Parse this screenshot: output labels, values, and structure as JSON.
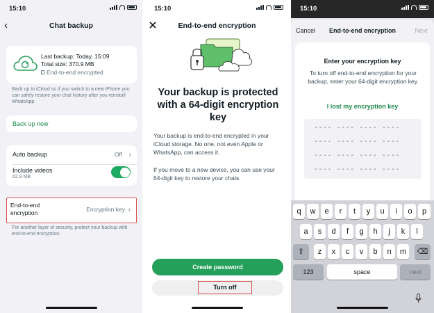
{
  "status_bar": {
    "time": "15:10"
  },
  "screen1": {
    "title": "Chat backup",
    "last_backup": "Last backup: Today, 15:09",
    "total_size": "Total size: 370.9 MB",
    "encrypted": "End-to-end encrypted",
    "note": "Back up to iCloud so if you switch to a new iPhone you can safely restore your chat history after you reinstall WhatsApp.",
    "backup_now": "Back up now",
    "auto_backup": "Auto backup",
    "auto_backup_value": "Off",
    "include_videos": "Include videos",
    "include_videos_size": "62.9 MB",
    "include_videos_on": true,
    "e2e_label": "End-to-end encryption",
    "e2e_value": "Encryption key",
    "e2e_note": "For another layer of security, protect your backup with end-to-end encryption."
  },
  "screen2": {
    "title": "End-to-end encryption",
    "headline": "Your backup is protected with a 64-digit encryption key",
    "para1": "Your backup is end-to-end encrypted in your iCloud storage. No one, not even Apple or WhatsApp, can access it.",
    "para2": "If you move to a new device, you can use your 64-digit key to restore your chats.",
    "create_password": "Create password",
    "turn_off": "Turn off"
  },
  "screen3": {
    "cancel": "Cancel",
    "title": "End-to-end encryption",
    "next": "Next",
    "enter_title": "Enter your encryption key",
    "enter_desc": "To turn off end-to-end encryption for your backup, enter your 64-digit encryption key.",
    "lost_key": "I lost my encryption key",
    "key_rows": [
      "---- ---- ---- ----",
      "---- ---- ---- ----",
      "---- ---- ---- ----",
      "---- ---- ---- ----"
    ],
    "keyboard": {
      "row1": [
        "q",
        "w",
        "e",
        "r",
        "t",
        "y",
        "u",
        "i",
        "o",
        "p"
      ],
      "row2": [
        "a",
        "s",
        "d",
        "f",
        "g",
        "h",
        "j",
        "k",
        "l"
      ],
      "row3": [
        "z",
        "x",
        "c",
        "v",
        "b",
        "n",
        "m"
      ],
      "shift": "⇧",
      "delete": "⌫",
      "numbers": "123",
      "space": "space",
      "next": "next"
    }
  },
  "colors": {
    "accent_green": "#25a05a",
    "link_green": "#1f8a4c",
    "highlight_red": "#d9534f"
  }
}
